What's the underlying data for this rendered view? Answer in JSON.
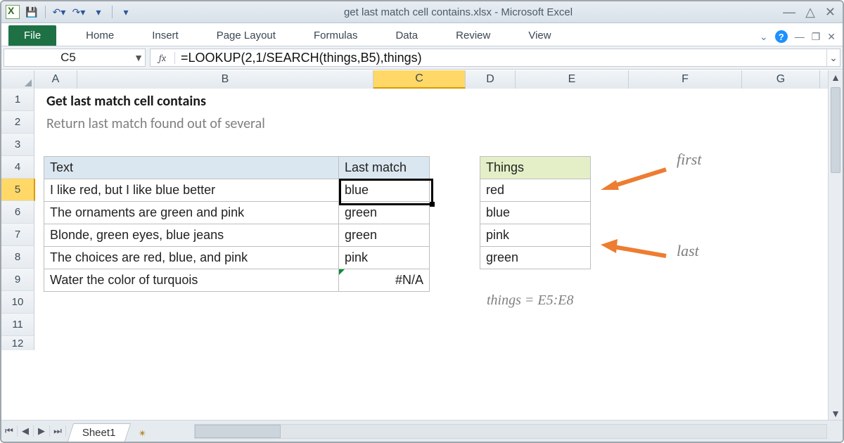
{
  "titlebar": {
    "title": "get last match cell contains.xlsx - Microsoft Excel"
  },
  "ribbon": {
    "file": "File",
    "tabs": [
      "Home",
      "Insert",
      "Page Layout",
      "Formulas",
      "Data",
      "Review",
      "View"
    ]
  },
  "namebox": "C5",
  "formula": "=LOOKUP(2,1/SEARCH(things,B5),things)",
  "columns": [
    "A",
    "B",
    "C",
    "D",
    "E",
    "F",
    "G"
  ],
  "selected_col_index": 2,
  "row_headers": [
    "1",
    "2",
    "3",
    "4",
    "5",
    "6",
    "7",
    "8",
    "9",
    "10",
    "11",
    "12"
  ],
  "selected_row_index": 4,
  "content": {
    "heading": "Get last match cell contains",
    "subheading": "Return last match found out of several",
    "table1": {
      "headers": [
        "Text",
        "Last match"
      ],
      "rows": [
        [
          "I like red, but I like blue better",
          "blue"
        ],
        [
          "The ornaments are green and pink",
          "green"
        ],
        [
          "Blonde, green eyes, blue jeans",
          "green"
        ],
        [
          "The choices are red, blue, and pink",
          "pink"
        ],
        [
          "Water the color of turquois",
          "#N/A"
        ]
      ]
    },
    "table2": {
      "header": "Things",
      "rows": [
        "red",
        "blue",
        "pink",
        "green"
      ]
    },
    "annot_first": "first",
    "annot_last": "last",
    "annot_range": "things = E5:E8"
  },
  "sheet_tab": "Sheet1"
}
